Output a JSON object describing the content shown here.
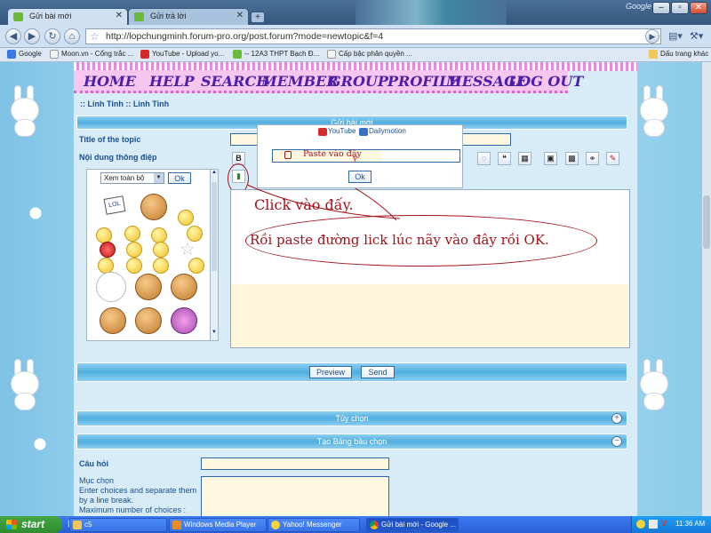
{
  "browser": {
    "tabs": [
      {
        "title": "Gửi bài mới",
        "active": true
      },
      {
        "title": "Gửi trả lời",
        "active": false
      }
    ],
    "brand": "Google",
    "url": "http://lopchungminh.forum-pro.org/post.forum?mode=newtopic&f=4",
    "bookmarks": [
      "Google",
      "Moon.vn - Cổng trắc ...",
      "YouTube - Upload yo...",
      "-- 12A3 THPT Bạch Đ...",
      "Cấp bậc phân quyền ..."
    ],
    "other_bookmarks": "Dấu trang khác"
  },
  "forum": {
    "menu": [
      "HOME",
      "HELP",
      "SEARCH",
      "MEMBER",
      "GROUP",
      "PROFILE",
      "MESSAGE",
      "LOG OUT"
    ],
    "breadcrumb": ":: Linh Tinh :: Linh Tinh",
    "post_header": "Gửi bài mới",
    "topic_label": "Title of the topic",
    "message_label": "Nội dung thông điệp",
    "smiley_select": "Xem toàn bộ",
    "smiley_ok": "Ok",
    "bold_button": "B",
    "video_popup": {
      "youtube": "YouTube",
      "dailymotion": "Dailymotion",
      "input_value": "Paste vào đây",
      "cursor_char": "y",
      "ok_label": "Ok"
    },
    "annotation_click": "Click vào đấy.",
    "annotation_paste": "Rồi paste đường lick lúc nãy vào đây rồi OK.",
    "preview_label": "Preview",
    "send_label": "Send",
    "options_header": "Tùy chọn",
    "poll_header": "Tạo Bảng bầu chọn",
    "question_label": "Câu hỏi",
    "choices_label": "Mục chọn",
    "choices_help": "Enter choices and separate them by a line break.",
    "choices_max": "Maximum number of choices :",
    "expand_symbol": "+",
    "collapse_symbol": "−"
  },
  "taskbar": {
    "start": "start",
    "items": [
      "c5",
      "Windows Media Player",
      "Yahoo! Messenger",
      "Gửi bài mới - Google ..."
    ],
    "clock": "11:36 AM"
  },
  "colors": {
    "accent": "#4faedf",
    "menu_text": "#4b1fa8",
    "menu_bg": "#f6c6ee",
    "annotation": "#a3121a",
    "taskbar": "#2a5fd6"
  },
  "icons": [
    "back-arrow-icon",
    "forward-arrow-icon",
    "reload-icon",
    "home-icon",
    "star-icon",
    "page-icon",
    "wrench-icon"
  ]
}
